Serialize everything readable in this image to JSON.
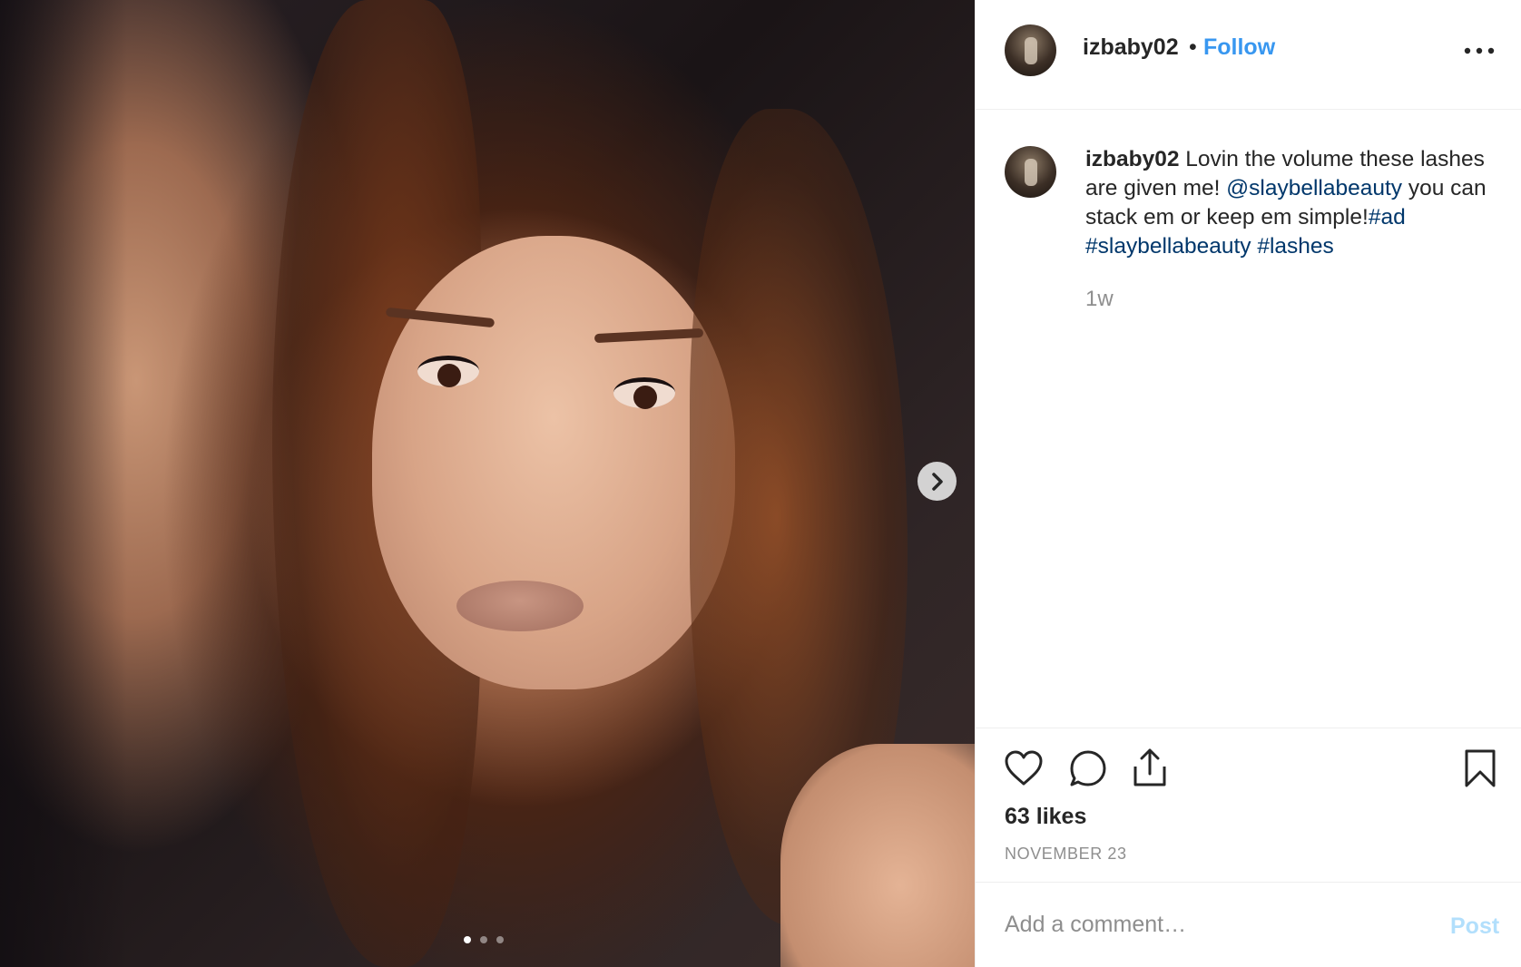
{
  "post": {
    "username": "izbaby02",
    "separator": "•",
    "follow_label": "Follow",
    "media_dots": 3,
    "active_dot": 1
  },
  "caption": {
    "username": "izbaby02",
    "text_1": " Lovin the volume these lashes are given me! ",
    "mention": "@slaybellabeauty",
    "text_2": " you can stack em or keep em simple!",
    "hashtag_1": "#ad",
    "hashtag_2": "#slaybellabeauty",
    "hashtag_3": "#lashes",
    "time": "1w"
  },
  "engagement": {
    "likes": "63 likes",
    "date": "NOVEMBER 23"
  },
  "comment": {
    "placeholder": "Add a comment…",
    "post_label": "Post"
  },
  "colors": {
    "link": "#00376b",
    "follow": "#3897f0",
    "post_disabled": "#b2dffc"
  }
}
